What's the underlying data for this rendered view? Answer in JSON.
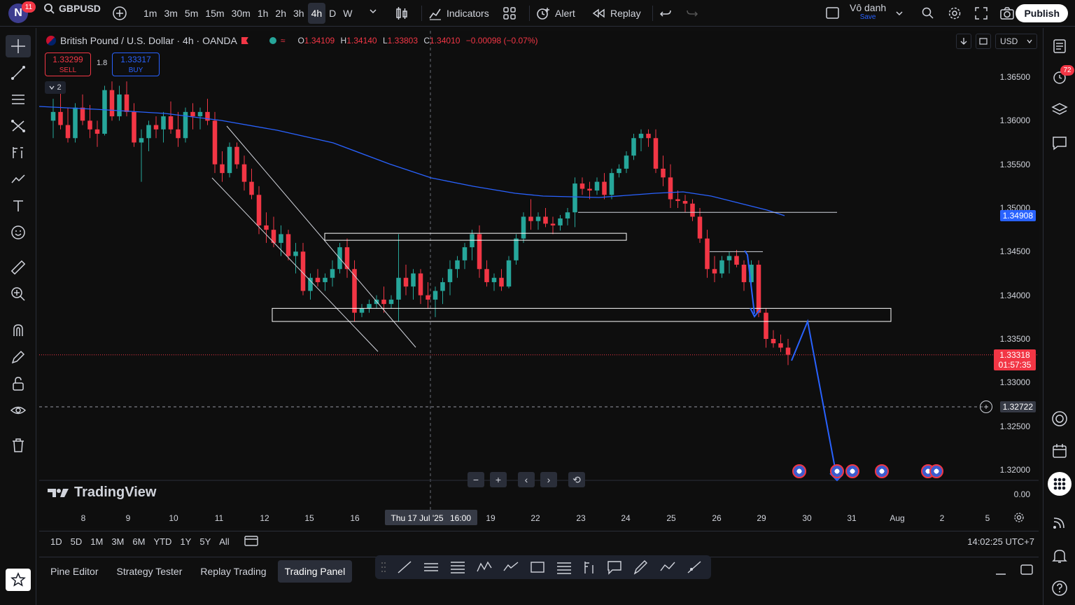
{
  "topbar": {
    "logo_letter": "N",
    "logo_badge": "11",
    "symbol": "GBPUSD",
    "timeframes": [
      "1m",
      "3m",
      "5m",
      "15m",
      "30m",
      "1h",
      "2h",
      "3h",
      "4h",
      "D",
      "W"
    ],
    "active_timeframe": "4h",
    "indicators_label": "Indicators",
    "alert_label": "Alert",
    "replay_label": "Replay",
    "layout_name": "Vô danh",
    "layout_status": "Save",
    "publish_label": "Publish"
  },
  "legend": {
    "title": "British Pound / U.S. Dollar · 4h · OANDA",
    "open_label": "O",
    "open": "1.34109",
    "high_label": "H",
    "high": "1.34140",
    "low_label": "L",
    "low": "1.33803",
    "close_label": "C",
    "close": "1.34010",
    "change": "−0.00098 (−0.07%)",
    "sell_price": "1.33299",
    "sell_label": "SELL",
    "spread": "1.8",
    "buy_price": "1.33317",
    "buy_label": "BUY",
    "indicator_count": "2",
    "currency": "USD"
  },
  "price_axis": {
    "labels": [
      "1.36500",
      "1.36000",
      "1.35500",
      "1.35000",
      "1.34500",
      "1.34000",
      "1.33500",
      "1.33000",
      "1.32500",
      "1.32000",
      "0.00"
    ],
    "ma_tag": "1.34908",
    "last_price_tag": "1.33318",
    "countdown": "01:57:35",
    "crosshair_tag": "1.32722",
    "accent_blue": "#2962ff",
    "up_color": "#26a69a",
    "down_color": "#f23645"
  },
  "time_axis": {
    "labels": [
      "8",
      "9",
      "10",
      "11",
      "12",
      "15",
      "16",
      "19",
      "22",
      "23",
      "24",
      "25",
      "26",
      "29",
      "30",
      "31",
      "Aug",
      "2",
      "5"
    ],
    "crosshair_date": "Thu 17 Jul '25",
    "crosshair_time": "16:00"
  },
  "chart_data": {
    "type": "candlestick",
    "symbol": "GBPUSD",
    "interval": "4h",
    "ylim": [
      1.318,
      1.367
    ],
    "y_ticks": [
      1.365,
      1.36,
      1.355,
      1.35,
      1.345,
      1.34,
      1.335,
      1.33,
      1.325,
      1.32
    ],
    "candles": [
      [
        1.36,
        1.3625,
        1.358,
        1.361
      ],
      [
        1.361,
        1.3632,
        1.359,
        1.3595
      ],
      [
        1.3595,
        1.3615,
        1.3575,
        1.358
      ],
      [
        1.358,
        1.362,
        1.3575,
        1.3615
      ],
      [
        1.3615,
        1.363,
        1.3595,
        1.36
      ],
      [
        1.36,
        1.3618,
        1.358,
        1.359
      ],
      [
        1.359,
        1.36,
        1.357,
        1.3585
      ],
      [
        1.3585,
        1.364,
        1.3583,
        1.3635
      ],
      [
        1.3635,
        1.3645,
        1.36,
        1.3605
      ],
      [
        1.3605,
        1.364,
        1.36,
        1.363
      ],
      [
        1.363,
        1.3645,
        1.3605,
        1.361
      ],
      [
        1.361,
        1.362,
        1.357,
        1.3575
      ],
      [
        1.3575,
        1.359,
        1.353,
        1.358
      ],
      [
        1.358,
        1.36,
        1.3565,
        1.3595
      ],
      [
        1.3595,
        1.3605,
        1.358,
        1.359
      ],
      [
        1.359,
        1.361,
        1.3575,
        1.3605
      ],
      [
        1.3605,
        1.3622,
        1.3585,
        1.359
      ],
      [
        1.359,
        1.361,
        1.357,
        1.358
      ],
      [
        1.358,
        1.3615,
        1.3575,
        1.361
      ],
      [
        1.361,
        1.362,
        1.359,
        1.3605
      ],
      [
        1.3605,
        1.3615,
        1.359,
        1.361
      ],
      [
        1.361,
        1.3625,
        1.3595,
        1.36
      ],
      [
        1.36,
        1.361,
        1.354,
        1.355
      ],
      [
        1.355,
        1.3565,
        1.353,
        1.354
      ],
      [
        1.354,
        1.3575,
        1.3535,
        1.357
      ],
      [
        1.357,
        1.3575,
        1.3545,
        1.355
      ],
      [
        1.355,
        1.356,
        1.352,
        1.353
      ],
      [
        1.353,
        1.3545,
        1.351,
        1.3515
      ],
      [
        1.3515,
        1.3525,
        1.347,
        1.348
      ],
      [
        1.348,
        1.3495,
        1.346,
        1.3475
      ],
      [
        1.3475,
        1.349,
        1.3455,
        1.346
      ],
      [
        1.346,
        1.348,
        1.3445,
        1.347
      ],
      [
        1.347,
        1.3475,
        1.344,
        1.3445
      ],
      [
        1.3445,
        1.346,
        1.3425,
        1.345
      ],
      [
        1.345,
        1.346,
        1.34,
        1.3405
      ],
      [
        1.3405,
        1.3425,
        1.3395,
        1.342
      ],
      [
        1.342,
        1.343,
        1.341,
        1.3415
      ],
      [
        1.3415,
        1.3425,
        1.3405,
        1.342
      ],
      [
        1.342,
        1.344,
        1.341,
        1.343
      ],
      [
        1.343,
        1.346,
        1.3425,
        1.3455
      ],
      [
        1.3455,
        1.3465,
        1.342,
        1.343
      ],
      [
        1.343,
        1.344,
        1.337,
        1.338
      ],
      [
        1.338,
        1.339,
        1.3375,
        1.3385
      ],
      [
        1.3385,
        1.3395,
        1.338,
        1.339
      ],
      [
        1.339,
        1.34,
        1.3385,
        1.3395
      ],
      [
        1.3395,
        1.341,
        1.338,
        1.339
      ],
      [
        1.339,
        1.34,
        1.3385,
        1.3395
      ],
      [
        1.3395,
        1.347,
        1.337,
        1.342
      ],
      [
        1.342,
        1.3435,
        1.34,
        1.341
      ],
      [
        1.341,
        1.343,
        1.3395,
        1.3425
      ],
      [
        1.3425,
        1.343,
        1.339,
        1.34
      ],
      [
        1.34,
        1.3415,
        1.3385,
        1.3395
      ],
      [
        1.3395,
        1.341,
        1.3375,
        1.3405
      ],
      [
        1.3405,
        1.342,
        1.339,
        1.3415
      ],
      [
        1.3415,
        1.344,
        1.34,
        1.343
      ],
      [
        1.343,
        1.3445,
        1.342,
        1.344
      ],
      [
        1.344,
        1.346,
        1.343,
        1.3455
      ],
      [
        1.3455,
        1.3475,
        1.344,
        1.347
      ],
      [
        1.347,
        1.348,
        1.342,
        1.343
      ],
      [
        1.343,
        1.344,
        1.341,
        1.3415
      ],
      [
        1.3415,
        1.3425,
        1.3405,
        1.342
      ],
      [
        1.342,
        1.343,
        1.3405,
        1.341
      ],
      [
        1.341,
        1.3445,
        1.3408,
        1.344
      ],
      [
        1.344,
        1.347,
        1.3435,
        1.3465
      ],
      [
        1.3465,
        1.3495,
        1.346,
        1.349
      ],
      [
        1.349,
        1.351,
        1.3475,
        1.3485
      ],
      [
        1.3485,
        1.3495,
        1.3475,
        1.349
      ],
      [
        1.349,
        1.35,
        1.3478,
        1.3482
      ],
      [
        1.3482,
        1.349,
        1.347,
        1.348
      ],
      [
        1.348,
        1.3492,
        1.3474,
        1.3488
      ],
      [
        1.3488,
        1.35,
        1.348,
        1.3495
      ],
      [
        1.3495,
        1.3535,
        1.3478,
        1.3528
      ],
      [
        1.3528,
        1.3535,
        1.3515,
        1.3522
      ],
      [
        1.3522,
        1.353,
        1.351,
        1.352
      ],
      [
        1.352,
        1.3535,
        1.3515,
        1.353
      ],
      [
        1.353,
        1.354,
        1.351,
        1.3515
      ],
      [
        1.3515,
        1.3545,
        1.351,
        1.354
      ],
      [
        1.354,
        1.355,
        1.3535,
        1.3545
      ],
      [
        1.3545,
        1.3565,
        1.354,
        1.356
      ],
      [
        1.356,
        1.3585,
        1.3555,
        1.358
      ],
      [
        1.358,
        1.359,
        1.3565,
        1.3585
      ],
      [
        1.3585,
        1.359,
        1.357,
        1.358
      ],
      [
        1.358,
        1.359,
        1.354,
        1.3545
      ],
      [
        1.3545,
        1.356,
        1.3525,
        1.3535
      ],
      [
        1.3535,
        1.355,
        1.35,
        1.351
      ],
      [
        1.351,
        1.352,
        1.35,
        1.3508
      ],
      [
        1.3508,
        1.3515,
        1.3495,
        1.3505
      ],
      [
        1.3505,
        1.351,
        1.3485,
        1.349
      ],
      [
        1.349,
        1.35,
        1.346,
        1.3465
      ],
      [
        1.3465,
        1.3475,
        1.342,
        1.343
      ],
      [
        1.343,
        1.3445,
        1.3415,
        1.3425
      ],
      [
        1.3425,
        1.3445,
        1.342,
        1.344
      ],
      [
        1.344,
        1.345,
        1.3425,
        1.3445
      ],
      [
        1.3445,
        1.3452,
        1.3432,
        1.3435
      ],
      [
        1.3435,
        1.344,
        1.3405,
        1.3415
      ],
      [
        1.3415,
        1.344,
        1.341,
        1.3435
      ],
      [
        1.3435,
        1.344,
        1.3375,
        1.338
      ],
      [
        1.338,
        1.3385,
        1.334,
        1.335
      ],
      [
        1.335,
        1.336,
        1.334,
        1.3345
      ],
      [
        1.3345,
        1.3355,
        1.3335,
        1.334
      ],
      [
        1.334,
        1.335,
        1.332,
        1.3332
      ]
    ],
    "moving_average": {
      "name": "",
      "color": "#2962ff"
    },
    "zones": [
      [
        1.3463,
        1.3471
      ],
      [
        1.337,
        1.3385
      ]
    ],
    "horizontal_levels": [
      1.3495,
      1.345
    ],
    "projection": [
      [
        1.3325,
        1.337
      ],
      [
        1.337,
        1.3195
      ]
    ],
    "current_price": 1.33318,
    "crosshair_price": 1.32722,
    "crosshair_time": "Thu 17 Jul '25 16:00"
  },
  "controls": {
    "zoom_out": "−",
    "zoom_in": "+",
    "scroll_left": "‹",
    "scroll_right": "›",
    "reset": "⟲",
    "brand": "TradingView"
  },
  "range_bar": {
    "ranges": [
      "1D",
      "5D",
      "1M",
      "3M",
      "6M",
      "YTD",
      "1Y",
      "5Y",
      "All"
    ],
    "clock": "14:02:25 UTC+7"
  },
  "bottom_tabs": [
    "Pine Editor",
    "Strategy Tester",
    "Replay Trading",
    "Trading Panel"
  ],
  "active_bottom_tab": "Trading Panel",
  "right_badge": "72"
}
